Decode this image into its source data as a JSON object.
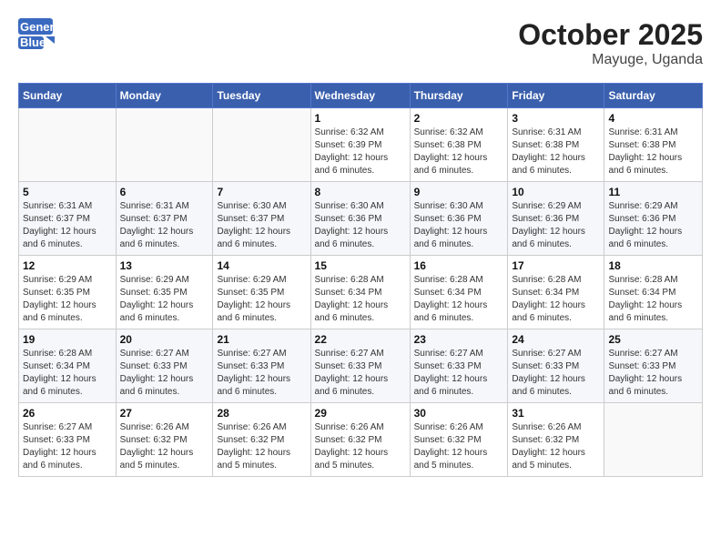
{
  "header": {
    "logo_general": "General",
    "logo_blue": "Blue",
    "month": "October 2025",
    "location": "Mayuge, Uganda"
  },
  "days_of_week": [
    "Sunday",
    "Monday",
    "Tuesday",
    "Wednesday",
    "Thursday",
    "Friday",
    "Saturday"
  ],
  "weeks": [
    [
      {
        "day": "",
        "info": ""
      },
      {
        "day": "",
        "info": ""
      },
      {
        "day": "",
        "info": ""
      },
      {
        "day": "1",
        "sunrise": "Sunrise: 6:32 AM",
        "sunset": "Sunset: 6:39 PM",
        "daylight": "Daylight: 12 hours and 6 minutes."
      },
      {
        "day": "2",
        "sunrise": "Sunrise: 6:32 AM",
        "sunset": "Sunset: 6:38 PM",
        "daylight": "Daylight: 12 hours and 6 minutes."
      },
      {
        "day": "3",
        "sunrise": "Sunrise: 6:31 AM",
        "sunset": "Sunset: 6:38 PM",
        "daylight": "Daylight: 12 hours and 6 minutes."
      },
      {
        "day": "4",
        "sunrise": "Sunrise: 6:31 AM",
        "sunset": "Sunset: 6:38 PM",
        "daylight": "Daylight: 12 hours and 6 minutes."
      }
    ],
    [
      {
        "day": "5",
        "sunrise": "Sunrise: 6:31 AM",
        "sunset": "Sunset: 6:37 PM",
        "daylight": "Daylight: 12 hours and 6 minutes."
      },
      {
        "day": "6",
        "sunrise": "Sunrise: 6:31 AM",
        "sunset": "Sunset: 6:37 PM",
        "daylight": "Daylight: 12 hours and 6 minutes."
      },
      {
        "day": "7",
        "sunrise": "Sunrise: 6:30 AM",
        "sunset": "Sunset: 6:37 PM",
        "daylight": "Daylight: 12 hours and 6 minutes."
      },
      {
        "day": "8",
        "sunrise": "Sunrise: 6:30 AM",
        "sunset": "Sunset: 6:36 PM",
        "daylight": "Daylight: 12 hours and 6 minutes."
      },
      {
        "day": "9",
        "sunrise": "Sunrise: 6:30 AM",
        "sunset": "Sunset: 6:36 PM",
        "daylight": "Daylight: 12 hours and 6 minutes."
      },
      {
        "day": "10",
        "sunrise": "Sunrise: 6:29 AM",
        "sunset": "Sunset: 6:36 PM",
        "daylight": "Daylight: 12 hours and 6 minutes."
      },
      {
        "day": "11",
        "sunrise": "Sunrise: 6:29 AM",
        "sunset": "Sunset: 6:36 PM",
        "daylight": "Daylight: 12 hours and 6 minutes."
      }
    ],
    [
      {
        "day": "12",
        "sunrise": "Sunrise: 6:29 AM",
        "sunset": "Sunset: 6:35 PM",
        "daylight": "Daylight: 12 hours and 6 minutes."
      },
      {
        "day": "13",
        "sunrise": "Sunrise: 6:29 AM",
        "sunset": "Sunset: 6:35 PM",
        "daylight": "Daylight: 12 hours and 6 minutes."
      },
      {
        "day": "14",
        "sunrise": "Sunrise: 6:29 AM",
        "sunset": "Sunset: 6:35 PM",
        "daylight": "Daylight: 12 hours and 6 minutes."
      },
      {
        "day": "15",
        "sunrise": "Sunrise: 6:28 AM",
        "sunset": "Sunset: 6:34 PM",
        "daylight": "Daylight: 12 hours and 6 minutes."
      },
      {
        "day": "16",
        "sunrise": "Sunrise: 6:28 AM",
        "sunset": "Sunset: 6:34 PM",
        "daylight": "Daylight: 12 hours and 6 minutes."
      },
      {
        "day": "17",
        "sunrise": "Sunrise: 6:28 AM",
        "sunset": "Sunset: 6:34 PM",
        "daylight": "Daylight: 12 hours and 6 minutes."
      },
      {
        "day": "18",
        "sunrise": "Sunrise: 6:28 AM",
        "sunset": "Sunset: 6:34 PM",
        "daylight": "Daylight: 12 hours and 6 minutes."
      }
    ],
    [
      {
        "day": "19",
        "sunrise": "Sunrise: 6:28 AM",
        "sunset": "Sunset: 6:34 PM",
        "daylight": "Daylight: 12 hours and 6 minutes."
      },
      {
        "day": "20",
        "sunrise": "Sunrise: 6:27 AM",
        "sunset": "Sunset: 6:33 PM",
        "daylight": "Daylight: 12 hours and 6 minutes."
      },
      {
        "day": "21",
        "sunrise": "Sunrise: 6:27 AM",
        "sunset": "Sunset: 6:33 PM",
        "daylight": "Daylight: 12 hours and 6 minutes."
      },
      {
        "day": "22",
        "sunrise": "Sunrise: 6:27 AM",
        "sunset": "Sunset: 6:33 PM",
        "daylight": "Daylight: 12 hours and 6 minutes."
      },
      {
        "day": "23",
        "sunrise": "Sunrise: 6:27 AM",
        "sunset": "Sunset: 6:33 PM",
        "daylight": "Daylight: 12 hours and 6 minutes."
      },
      {
        "day": "24",
        "sunrise": "Sunrise: 6:27 AM",
        "sunset": "Sunset: 6:33 PM",
        "daylight": "Daylight: 12 hours and 6 minutes."
      },
      {
        "day": "25",
        "sunrise": "Sunrise: 6:27 AM",
        "sunset": "Sunset: 6:33 PM",
        "daylight": "Daylight: 12 hours and 6 minutes."
      }
    ],
    [
      {
        "day": "26",
        "sunrise": "Sunrise: 6:27 AM",
        "sunset": "Sunset: 6:33 PM",
        "daylight": "Daylight: 12 hours and 6 minutes."
      },
      {
        "day": "27",
        "sunrise": "Sunrise: 6:26 AM",
        "sunset": "Sunset: 6:32 PM",
        "daylight": "Daylight: 12 hours and 5 minutes."
      },
      {
        "day": "28",
        "sunrise": "Sunrise: 6:26 AM",
        "sunset": "Sunset: 6:32 PM",
        "daylight": "Daylight: 12 hours and 5 minutes."
      },
      {
        "day": "29",
        "sunrise": "Sunrise: 6:26 AM",
        "sunset": "Sunset: 6:32 PM",
        "daylight": "Daylight: 12 hours and 5 minutes."
      },
      {
        "day": "30",
        "sunrise": "Sunrise: 6:26 AM",
        "sunset": "Sunset: 6:32 PM",
        "daylight": "Daylight: 12 hours and 5 minutes."
      },
      {
        "day": "31",
        "sunrise": "Sunrise: 6:26 AM",
        "sunset": "Sunset: 6:32 PM",
        "daylight": "Daylight: 12 hours and 5 minutes."
      },
      {
        "day": "",
        "info": ""
      }
    ]
  ]
}
